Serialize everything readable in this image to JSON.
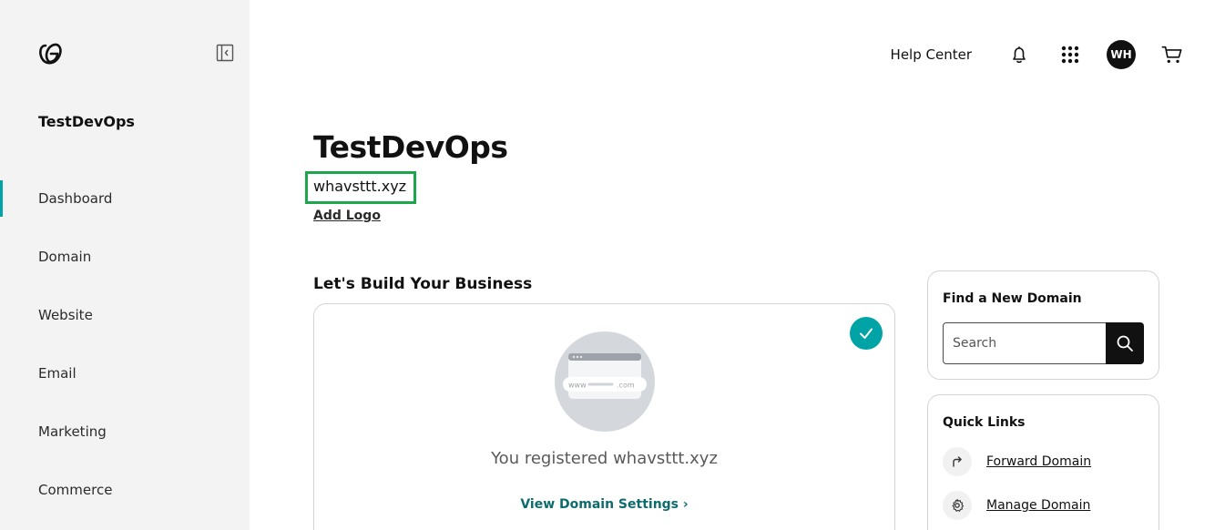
{
  "sidebar": {
    "account_name": "TestDevOps",
    "items": [
      {
        "label": "Dashboard",
        "active": true
      },
      {
        "label": "Domain"
      },
      {
        "label": "Website"
      },
      {
        "label": "Email"
      },
      {
        "label": "Marketing"
      },
      {
        "label": "Commerce"
      }
    ]
  },
  "header": {
    "help_label": "Help Center",
    "avatar_initials": "WH",
    "icons": [
      "bell-icon",
      "apps-grid-icon",
      "cart-icon"
    ]
  },
  "main": {
    "title": "TestDevOps",
    "domain": "whavsttt.xyz",
    "add_logo": "Add Logo",
    "section_title": "Let's Build Your Business",
    "card": {
      "illustration_www": "www",
      "illustration_com": ".com",
      "registered_text": "You registered whavsttt.xyz",
      "link_label": "View Domain Settings",
      "link_chevron": "›"
    }
  },
  "find_domain": {
    "title": "Find a New Domain",
    "placeholder": "Search"
  },
  "quick_links": {
    "title": "Quick Links",
    "items": [
      {
        "label": "Forward Domain",
        "icon": "forward-arrow-icon"
      },
      {
        "label": "Manage Domain",
        "icon": "gear-icon"
      }
    ]
  },
  "colors": {
    "accent": "#00a4a6",
    "highlight_border": "#1ea64d",
    "link_teal": "#0e6b6c",
    "sidebar_bg": "#f3f3f3"
  }
}
